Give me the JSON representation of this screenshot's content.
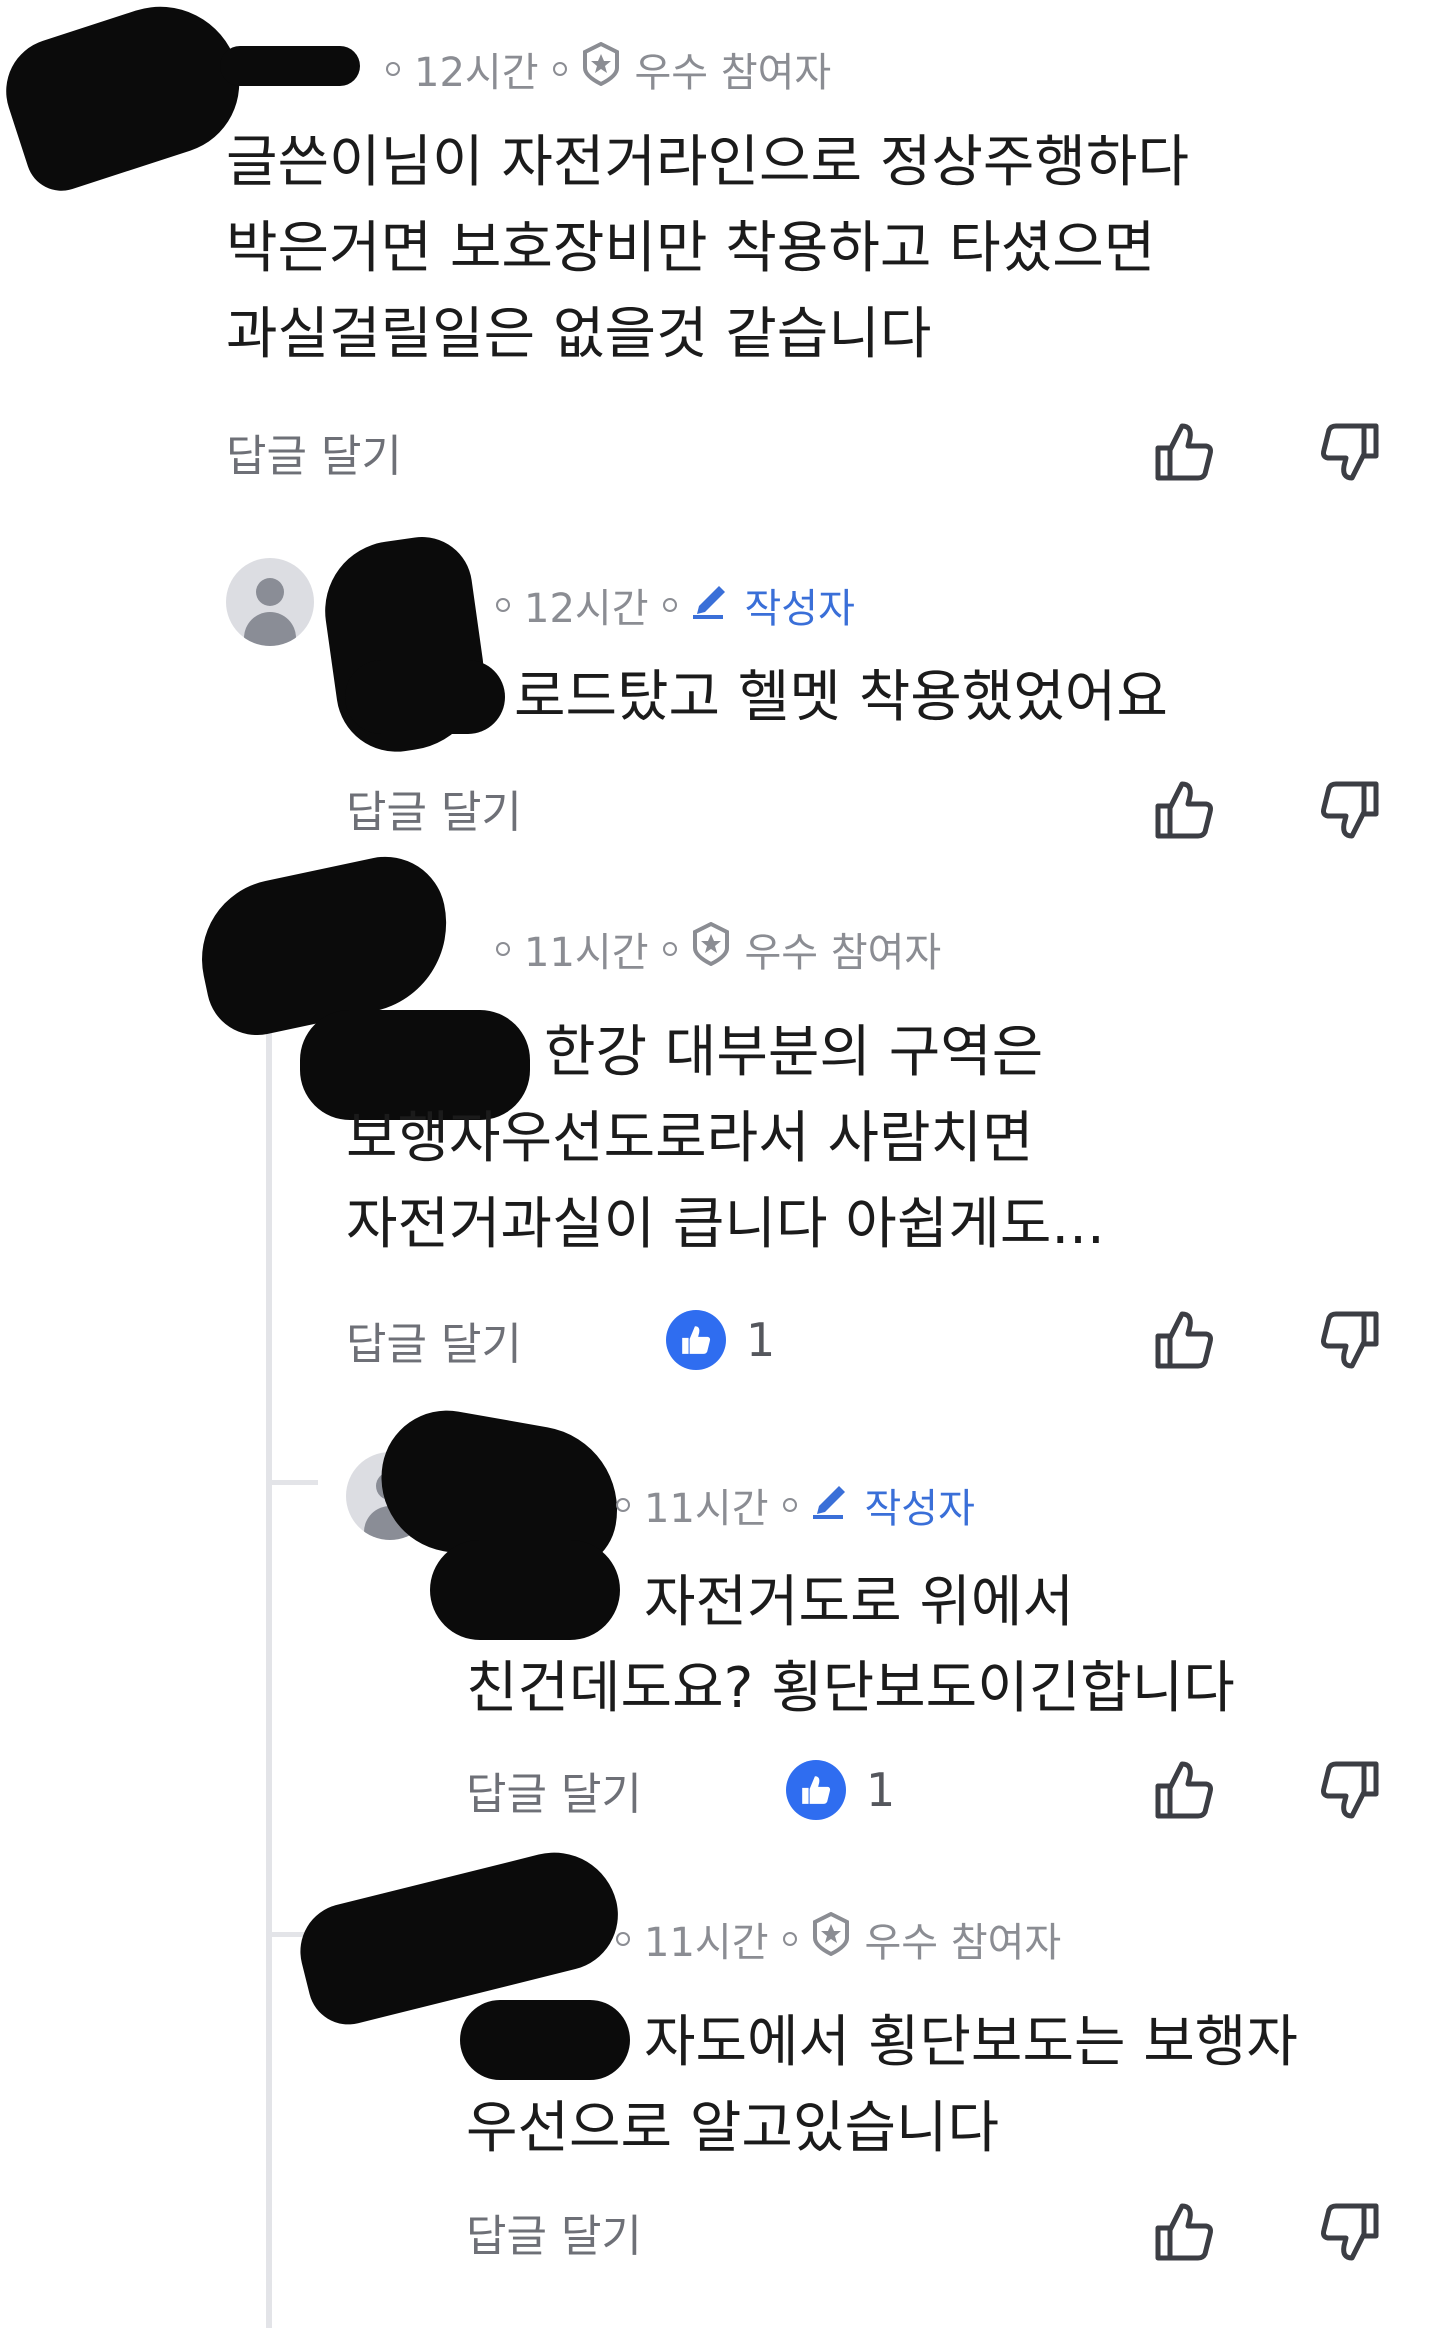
{
  "labels": {
    "reply": "답글 달기",
    "badge_best": "우수 참여자",
    "badge_author": "작성자"
  },
  "comments": [
    {
      "time": "12시간",
      "lines": [
        "글쓴이님이 자전거라인으로 정상주행하다",
        "박은거면 보호장비만 착용하고 타셨으면",
        "과실걸릴일은 없을것 같습니다"
      ]
    },
    {
      "time": "12시간",
      "lines": [
        "로드탔고 헬멧 착용했었어요"
      ]
    },
    {
      "time": "11시간",
      "lines": [
        "한강 대부분의 구역은",
        "보행자우선도로라서 사람치면",
        "자전거과실이 큽니다 아쉽게도..."
      ],
      "likes": "1"
    },
    {
      "time": "11시간",
      "lines": [
        "자전거도로 위에서",
        "친건데도요? 횡단보도이긴합니다"
      ],
      "likes": "1"
    },
    {
      "time": "11시간",
      "lines": [
        "자도에서 횡단보도는 보행자",
        "우선으로 알고있습니다"
      ]
    }
  ],
  "colors": {
    "accent": "#3a6fd8",
    "meta": "#8b8d93",
    "like_bubble": "#2f6df0"
  },
  "icons": [
    "badge-star-icon",
    "pencil-icon",
    "thumbs-up-icon",
    "thumbs-down-icon"
  ]
}
